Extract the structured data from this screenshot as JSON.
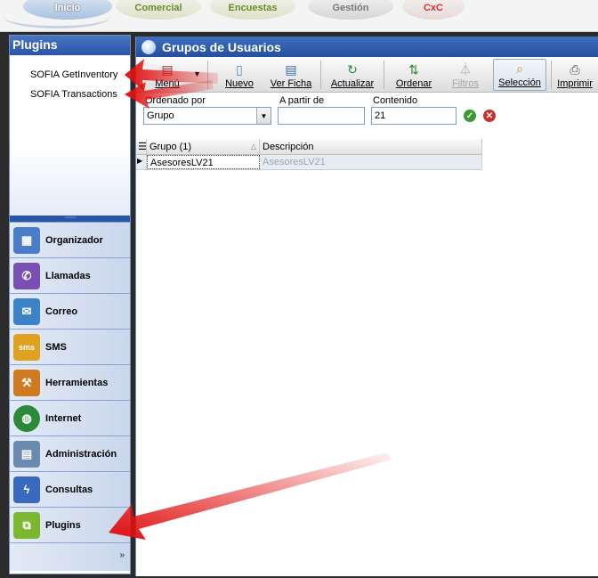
{
  "top_tabs": [
    "Inicio",
    "Comercial",
    "Encuestas",
    "Gestión",
    "CxC"
  ],
  "left_panel": {
    "title": "Plugins",
    "plugins": [
      "SOFIA GetInventory",
      "SOFIA Transactions"
    ],
    "nav": [
      {
        "label": "Organizador",
        "icon": "organizer-icon",
        "color": "#4a7cc9"
      },
      {
        "label": "Llamadas",
        "icon": "phone-icon",
        "color": "#7a4fb4"
      },
      {
        "label": "Correo",
        "icon": "mail-icon",
        "color": "#3b82c8"
      },
      {
        "label": "SMS",
        "icon": "sms-icon",
        "color": "#e0a020"
      },
      {
        "label": "Herramientas",
        "icon": "tools-icon",
        "color": "#d07a20"
      },
      {
        "label": "Internet",
        "icon": "globe-icon",
        "color": "#2a8a3a"
      },
      {
        "label": "Administración",
        "icon": "admin-icon",
        "color": "#6a8ab0"
      },
      {
        "label": "Consultas",
        "icon": "query-icon",
        "color": "#3a6ac0"
      },
      {
        "label": "Plugins",
        "icon": "plugin-icon",
        "color": "#7ab830"
      }
    ],
    "footer_chevron": "»"
  },
  "window": {
    "title": "Grupos de Usuarios",
    "toolbar": {
      "menu": "Menú",
      "new": "Nuevo",
      "view": "Ver Ficha",
      "refresh": "Actualizar",
      "sort": "Ordenar",
      "filters": "Filtros",
      "selection": "Selección",
      "print": "Imprimir"
    },
    "filter": {
      "order_label": "Ordenado por",
      "order_value": "Grupo",
      "from_label": "A partir de",
      "from_value": "",
      "content_label": "Contenido",
      "content_value": "21"
    },
    "grid": {
      "columns": [
        "Grupo (1)",
        "Descripción"
      ],
      "rows": [
        [
          "AsesoresLV21",
          "AsesoresLV21"
        ]
      ]
    }
  }
}
